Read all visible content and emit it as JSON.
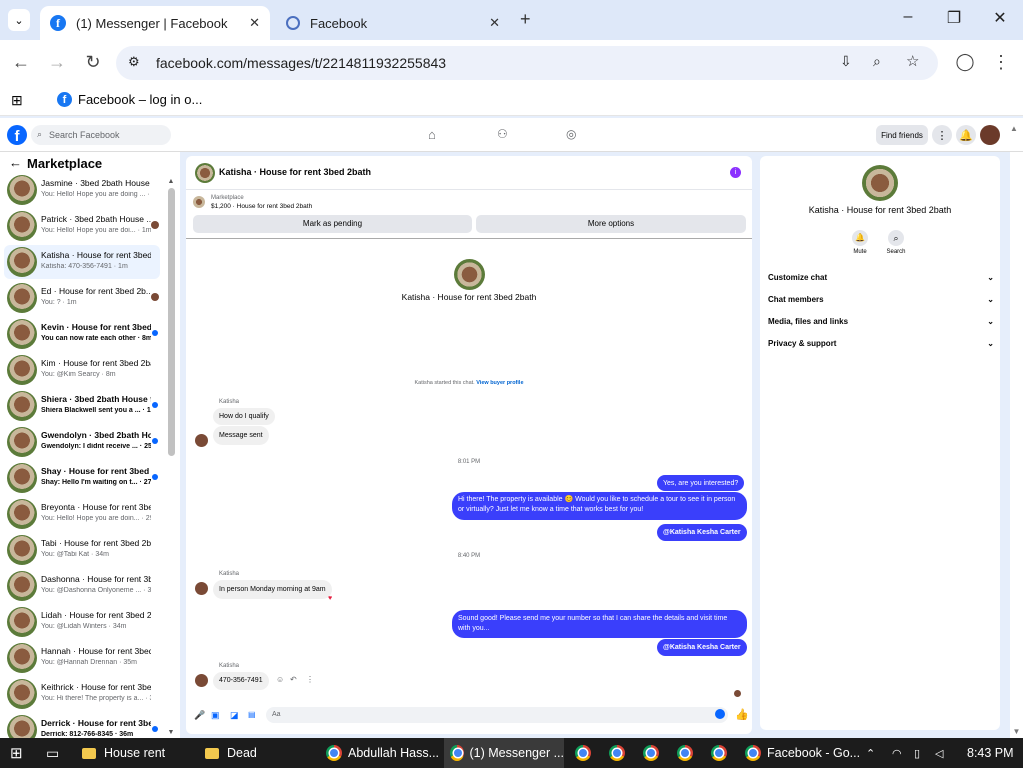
{
  "browser": {
    "tabs": [
      {
        "title": "(1) Messenger | Facebook"
      },
      {
        "title": "Facebook"
      }
    ],
    "url": "facebook.com/messages/t/2214811932255843",
    "bookmark": "Facebook – log in o..."
  },
  "fb": {
    "search_placeholder": "Search Facebook",
    "find_friends": "Find friends"
  },
  "sidebar": {
    "title": "Marketplace",
    "conversations": [
      {
        "name": "Jasmine · 3bed 2bath House f...",
        "preview": "You: Hello! Hope you are doing ... · 1m"
      },
      {
        "name": "Patrick · 3bed 2bath House ...",
        "preview": "You: Hello! Hope you are doi... · 1m"
      },
      {
        "name": "Katisha · House for rent 3bed ...",
        "preview": "Katisha: 470-356-7491 · 1m"
      },
      {
        "name": "Ed · House for rent 3bed 2b...",
        "preview": "You: ? · 1m"
      },
      {
        "name": "Kevin · House for rent 3bed ...",
        "preview": "You can now rate each other · 8m"
      },
      {
        "name": "Kim · House for rent 3bed 2ba...",
        "preview": "You: @Kim Searcy · 8m"
      },
      {
        "name": "Shiera · 3bed 2bath House f...",
        "preview": "Shiera Blackwell sent you a ... · 19m"
      },
      {
        "name": "Gwendolyn · 3bed 2bath Ho...",
        "preview": "Gwendolyn: I didnt receive ... · 25m"
      },
      {
        "name": "Shay · House for rent 3bed ...",
        "preview": "Shay: Hello I'm waiting on t... · 27m"
      },
      {
        "name": "Breyonta · House for rent 3be...",
        "preview": "You: Hello! Hope you are doin... · 29m"
      },
      {
        "name": "Tabi · House for rent 3bed 2ba...",
        "preview": "You: @Tabi Kat · 34m"
      },
      {
        "name": "Dashonna · House for rent 3b...",
        "preview": "You: @Dashonna Onlyoneme ... · 34m"
      },
      {
        "name": "Lidah · House for rent 3bed 2...",
        "preview": "You: @Lidah Winters · 34m"
      },
      {
        "name": "Hannah · House for rent 3bed...",
        "preview": "You: @Hannah Drennan · 35m"
      },
      {
        "name": "Keithrick · House for rent 3be...",
        "preview": "You: Hi there! The property is a... · 35m"
      },
      {
        "name": "Derrick · House for rent 3be...",
        "preview": "Derrick: 812-766-8345 · 36m"
      }
    ]
  },
  "chat": {
    "header_title": "Katisha · House for rent 3bed 2bath",
    "listing_label": "Marketplace",
    "listing_detail": "$1,200 · House for rent 3bed 2bath",
    "mark_pending": "Mark as pending",
    "more_options": "More options",
    "intro_name": "Katisha · House for rent 3bed 2bath",
    "started_text": "Katisha started this chat.",
    "view_profile": "View buyer profile",
    "messages": {
      "sender1": "Katisha",
      "m1": "How do I qualify",
      "m2": "Message sent",
      "time1": "8:01 PM",
      "m3": "Yes, are you interested?",
      "m4": "Hi there! The property is available 😊 Would you like to schedule a tour to see it in person or virtually? Just let me know a time that works best for you!",
      "m5": "@Katisha Kesha Carter",
      "time2": "8:40 PM",
      "sender2": "Katisha",
      "m6": "In person Monday morning at 9am",
      "m7": "Sound good! Please send me your number so that I can share the details and visit time with you...",
      "m8": "@Katisha Kesha Carter",
      "sender3": "Katisha",
      "m9": "470-356-7491"
    },
    "composer_placeholder": "Aa"
  },
  "info": {
    "name": "Katisha · House for rent 3bed 2bath",
    "mute": "Mute",
    "search": "Search",
    "rows": [
      "Customize chat",
      "Chat members",
      "Media, files and links",
      "Privacy & support"
    ]
  },
  "taskbar": {
    "items": [
      "House rent",
      "Dead",
      "Abdullah Hass...",
      "(1) Messenger ...",
      "Facebook - Go..."
    ],
    "time": "8:43 PM"
  }
}
